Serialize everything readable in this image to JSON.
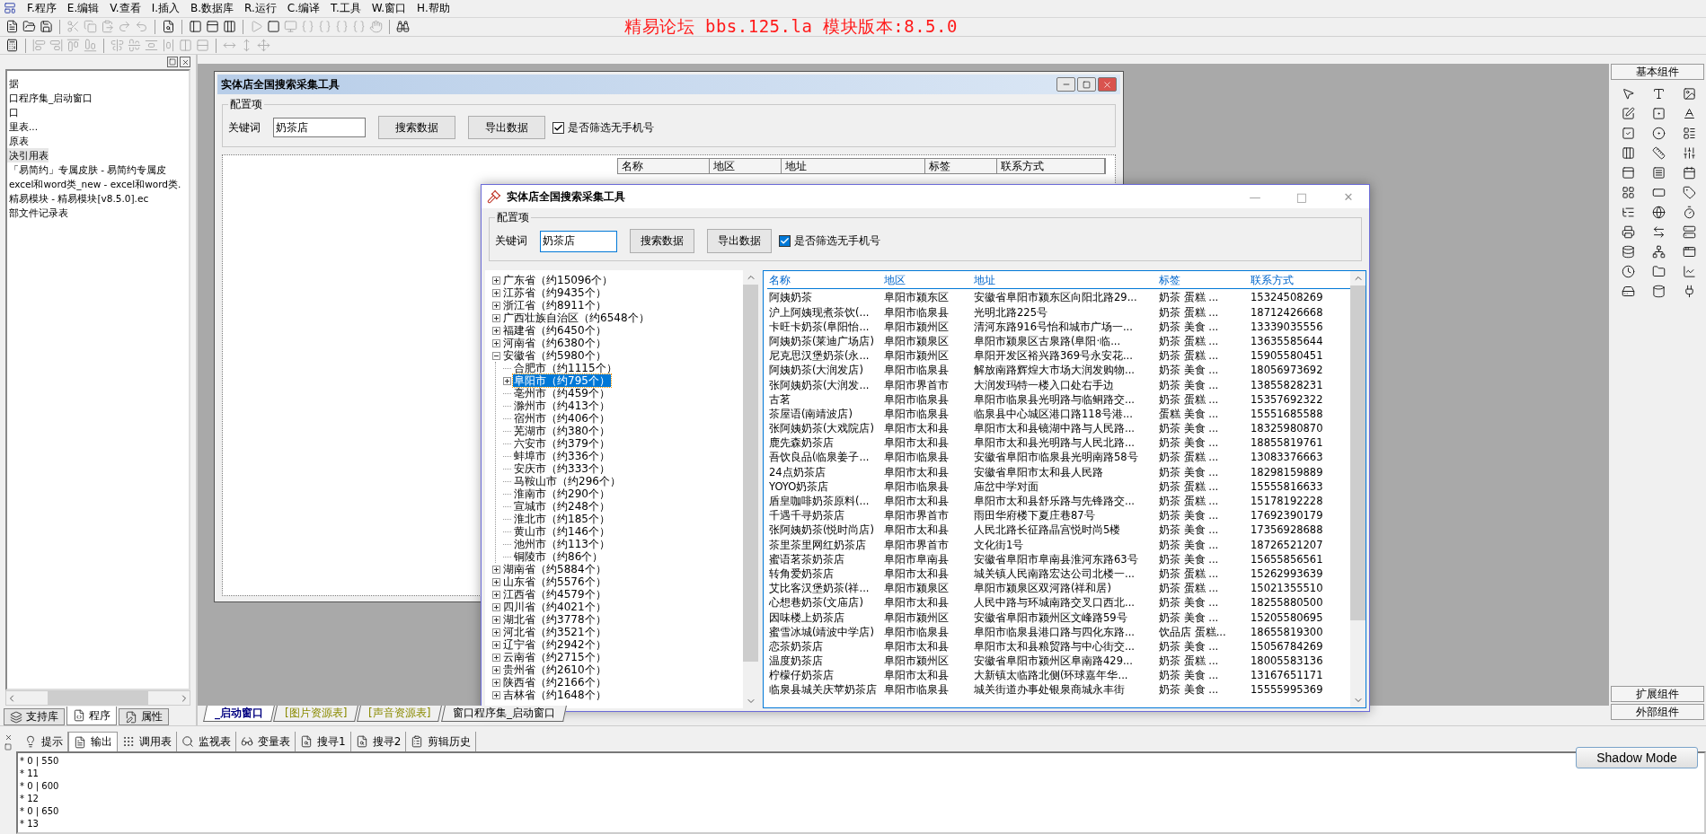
{
  "menu": [
    "F.程序",
    "E.编辑",
    "V.查看",
    "I.插入",
    "B.数据库",
    "R.运行",
    "C.编译",
    "T.工具",
    "W.窗口",
    "H.帮助"
  ],
  "banner": "精易论坛 bbs.125.la 模块版本:8.5.0",
  "project_tree": {
    "items": [
      {
        "label": "据",
        "selected": false
      },
      {
        "label": "口程序集_启动窗口",
        "selected": false
      },
      {
        "label": "口",
        "selected": false
      },
      {
        "label": "里表...",
        "selected": false
      },
      {
        "label": "原表",
        "selected": false
      },
      {
        "label": "决引用表",
        "selected": true
      },
      {
        "label": "「易简约」专属皮肤 - 易简约专属皮",
        "selected": false
      },
      {
        "label": "excel和word类_new - excel和word类.",
        "selected": false
      },
      {
        "label": "精易模块 - 精易模块[v8.5.0].ec",
        "selected": false
      },
      {
        "label": "部文件记录表",
        "selected": false
      }
    ]
  },
  "left_tabs": [
    {
      "label": "支持库",
      "selected": false
    },
    {
      "label": "程序",
      "selected": true
    },
    {
      "label": "属性",
      "selected": false
    }
  ],
  "design_form": {
    "title": "实体店全国搜索采集工具",
    "group_title": "配置项",
    "keyword_label": "关键词",
    "keyword_value": "奶茶店",
    "buttons": [
      "搜索数据",
      "导出数据"
    ],
    "filter": {
      "label": "是否筛选无手机号",
      "checked": true
    },
    "columns": [
      "名称",
      "地区",
      "地址",
      "标签",
      "联系方式"
    ]
  },
  "app_window": {
    "title": "实体店全国搜索采集工具",
    "controls": [
      "—",
      "□",
      "✕"
    ],
    "group_title": "配置项",
    "keyword_label": "关键词",
    "keyword_value": "奶茶店",
    "buttons": [
      "搜索数据",
      "导出数据"
    ],
    "filter": {
      "label": "是否筛选无手机号",
      "checked": true
    },
    "tree": [
      {
        "label": "广东省（约15096个）",
        "selected": false,
        "expanded": false
      },
      {
        "label": "江苏省（约9435个）",
        "selected": false,
        "expanded": false
      },
      {
        "label": "浙江省（约8911个）",
        "selected": false,
        "expanded": false
      },
      {
        "label": "广西壮族自治区（约6548个）",
        "selected": false,
        "expanded": false
      },
      {
        "label": "福建省（约6450个）",
        "selected": false,
        "expanded": false
      },
      {
        "label": "河南省（约6380个）",
        "selected": false,
        "expanded": false
      },
      {
        "label": "安徽省（约5980个）",
        "selected": false,
        "expanded": true,
        "children": [
          {
            "label": "合肥市（约1115个）",
            "selected": false
          },
          {
            "label": "阜阳市（约795个）",
            "selected": true,
            "expanded": false
          },
          {
            "label": "亳州市（约459个）",
            "selected": false
          },
          {
            "label": "滁州市（约413个）",
            "selected": false
          },
          {
            "label": "宿州市（约406个）",
            "selected": false
          },
          {
            "label": "芜湖市（约380个）",
            "selected": false
          },
          {
            "label": "六安市（约379个）",
            "selected": false
          },
          {
            "label": "蚌埠市（约336个）",
            "selected": false
          },
          {
            "label": "安庆市（约333个）",
            "selected": false
          },
          {
            "label": "马鞍山市（约296个）",
            "selected": false
          },
          {
            "label": "淮南市（约290个）",
            "selected": false
          },
          {
            "label": "宣城市（约248个）",
            "selected": false
          },
          {
            "label": "淮北市（约185个）",
            "selected": false
          },
          {
            "label": "黄山市（约146个）",
            "selected": false
          },
          {
            "label": "池州市（约113个）",
            "selected": false
          },
          {
            "label": "铜陵市（约86个）",
            "selected": false
          }
        ]
      },
      {
        "label": "湖南省（约5884个）",
        "selected": false,
        "expanded": false
      },
      {
        "label": "山东省（约5576个）",
        "selected": false,
        "expanded": false
      },
      {
        "label": "江西省（约4579个）",
        "selected": false,
        "expanded": false
      },
      {
        "label": "四川省（约4021个）",
        "selected": false,
        "expanded": false
      },
      {
        "label": "湖北省（约3778个）",
        "selected": false,
        "expanded": false
      },
      {
        "label": "河北省（约3521个）",
        "selected": false,
        "expanded": false
      },
      {
        "label": "辽宁省（约2942个）",
        "selected": false,
        "expanded": false
      },
      {
        "label": "云南省（约2715个）",
        "selected": false,
        "expanded": false
      },
      {
        "label": "贵州省（约2610个）",
        "selected": false,
        "expanded": false
      },
      {
        "label": "陕西省（约2166个）",
        "selected": false,
        "expanded": false
      },
      {
        "label": "吉林省（约1648个）",
        "selected": false,
        "expanded": false
      }
    ],
    "table": {
      "columns": [
        "名称",
        "地区",
        "地址",
        "标签",
        "联系方式"
      ],
      "rows": [
        [
          "阿姨奶茶",
          "阜阳市颍东区",
          "安徽省阜阳市颍东区向阳北路29...",
          "奶茶 蛋糕 ...",
          "15324508269"
        ],
        [
          "沪上阿姨现煮茶饮(...",
          "阜阳市临泉县",
          "光明北路225号",
          "奶茶 蛋糕 ...",
          "18712426668"
        ],
        [
          "卡旺卡奶茶(阜阳怡...",
          "阜阳市颍州区",
          "清河东路916号怡和城市广场一...",
          "奶茶 美食 ...",
          "13339035556"
        ],
        [
          "阿姨奶茶(莱迪广场店)",
          "阜阳市颍泉区",
          "阜阳市颍泉区古泉路(阜阳·临...",
          "奶茶 蛋糕 ...",
          "13635585644"
        ],
        [
          "尼克思汉堡奶茶(永...",
          "阜阳市颍州区",
          "阜阳开发区裕兴路369号永安花...",
          "奶茶 蛋糕 ...",
          "15905580451"
        ],
        [
          "阿姨奶茶(大润发店)",
          "阜阳市临泉县",
          "解放南路辉煌大市场大润发购物...",
          "奶茶 美食 ...",
          "18056973692"
        ],
        [
          "张阿姨奶茶(大润发...",
          "阜阳市界首市",
          "大润发玛特一楼入口处右手边",
          "奶茶 美食 ...",
          "13855828231"
        ],
        [
          "古茗",
          "阜阳市临泉县",
          "阜阳市临泉县光明路与临鲖路交...",
          "奶茶 蛋糕 ...",
          "15357692322"
        ],
        [
          "茶屋语(南靖波店)",
          "阜阳市临泉县",
          "临泉县中心城区港口路118号港...",
          "蛋糕 美食 ...",
          "15551685588"
        ],
        [
          "张阿姨奶茶(大戏院店)",
          "阜阳市太和县",
          "阜阳市太和县镜湖中路与人民路...",
          "奶茶 美食 ...",
          "18325980870"
        ],
        [
          "鹿先森奶茶店",
          "阜阳市太和县",
          "阜阳市太和县光明路与人民北路...",
          "奶茶 美食 ...",
          "18855819761"
        ],
        [
          "吾饮良品(临泉姜子...",
          "阜阳市临泉县",
          "安徽省阜阳市临泉县光明南路58号",
          "奶茶 蛋糕 ...",
          "13083376663"
        ],
        [
          "24点奶茶店",
          "阜阳市太和县",
          "安徽省阜阳市太和县人民路",
          "奶茶 美食 ...",
          "18298159889"
        ],
        [
          "YOYO奶茶店",
          "阜阳市临泉县",
          "庙岔中学对面",
          "奶茶 蛋糕 ...",
          "15555816633"
        ],
        [
          "盾皇咖啡奶茶原料(...",
          "阜阳市太和县",
          "阜阳市太和县舒乐路与先锋路交...",
          "奶茶 蛋糕 ...",
          "15178192228"
        ],
        [
          "千遇千寻奶茶店",
          "阜阳市界首市",
          "雨田华府楼下夏庄巷87号",
          "奶茶 美食 ...",
          "17692390179"
        ],
        [
          "张阿姨奶茶(悦时尚店)",
          "阜阳市太和县",
          "人民北路长征路晶宫悦时尚5楼",
          "奶茶 美食 ...",
          "17356928688"
        ],
        [
          "茶里茶里网红奶茶店",
          "阜阳市界首市",
          "文化街1号",
          "奶茶 美食 ...",
          "18726521207"
        ],
        [
          "蜜语茗茶奶茶店",
          "阜阳市阜南县",
          "安徽省阜阳市阜南县淮河东路63号",
          "奶茶 美食 ...",
          "15655856561"
        ],
        [
          "转角爱奶茶店",
          "阜阳市太和县",
          "城关镇人民南路宏达公司北楼一...",
          "奶茶 蛋糕 ...",
          "15262993639"
        ],
        [
          "艾比客汉堡奶茶(祥...",
          "阜阳市颍泉区",
          "阜阳市颍泉区双河路(祥和居)",
          "奶茶 蛋糕 ...",
          "15021355510"
        ],
        [
          "心想巷奶茶(文庙店)",
          "阜阳市太和县",
          "人民中路与环城南路交叉口西北...",
          "奶茶 美食 ...",
          "18255880500"
        ],
        [
          "因味楼上奶茶店",
          "阜阳市颍州区",
          "安徽省阜阳市颍州区文峰路59号",
          "奶茶 美食 ...",
          "15205580695"
        ],
        [
          "蜜雪冰城(靖波中学店)",
          "阜阳市临泉县",
          "阜阳市临泉县港口路与四化东路...",
          "饮品店 蛋糕...",
          "18655819300"
        ],
        [
          "恋茶奶茶店",
          "阜阳市太和县",
          "阜阳市太和县粮贸路与中心街交...",
          "奶茶 美食 ...",
          "15056784269"
        ],
        [
          "温度奶茶店",
          "阜阳市颍州区",
          "安徽省阜阳市颍州区阜南路429...",
          "奶茶 蛋糕 ...",
          "18005583136"
        ],
        [
          "柠檬仔奶茶店",
          "阜阳市太和县",
          "大新镇太临路北侧(环球嘉年华...",
          "奶茶 美食 ...",
          "13167651171"
        ],
        [
          "临泉县城关庆苹奶茶店",
          "阜阳市临泉县",
          "城关街道办事处银泉商城永丰街",
          "奶茶 美食 ...",
          "15555995369"
        ]
      ]
    }
  },
  "right_panel": {
    "title": "基本组件",
    "sections": [
      "扩展组件",
      "外部组件"
    ]
  },
  "editor_tabs": [
    {
      "label": "_启动窗口",
      "selected": true,
      "kind": "window"
    },
    {
      "label": "[图片资源表]",
      "selected": false,
      "kind": "resource"
    },
    {
      "label": "[声音资源表]",
      "selected": false,
      "kind": "resource"
    },
    {
      "label": "窗口程序集_启动窗口",
      "selected": false,
      "kind": "code"
    }
  ],
  "output_tabs": [
    {
      "label": "提示",
      "selected": false
    },
    {
      "label": "输出",
      "selected": true
    },
    {
      "label": "调用表",
      "selected": false
    },
    {
      "label": "监视表",
      "selected": false
    },
    {
      "label": "变量表",
      "selected": false
    },
    {
      "label": "搜寻1",
      "selected": false
    },
    {
      "label": "搜寻2",
      "selected": false
    },
    {
      "label": "剪辑历史",
      "selected": false
    }
  ],
  "output_lines": [
    "* 0 | 550",
    "* 11",
    "* 0 | 600",
    "* 12",
    "* 0 | 650",
    "* 13"
  ],
  "shadow_button": "Shadow Mode"
}
